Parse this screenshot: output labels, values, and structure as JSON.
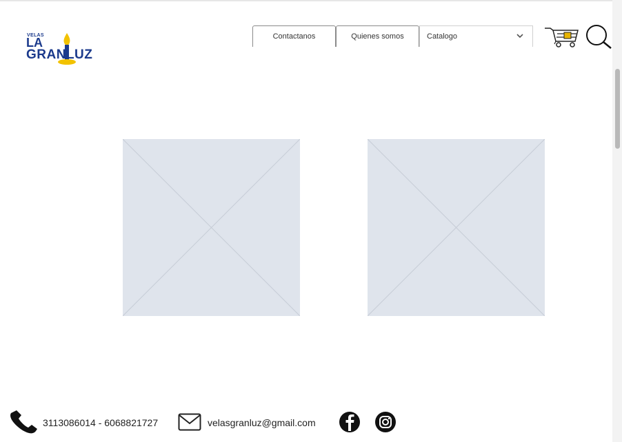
{
  "logo": {
    "small": "VELAS",
    "line1": "LA",
    "line2": "GRANLUZ"
  },
  "nav": {
    "contact_label": "Contactanos",
    "about_label": "Quienes somos",
    "catalog_selected": "Catalogo"
  },
  "icons": {
    "cart": "shopping-cart-icon",
    "search": "search-icon",
    "phone": "phone-icon",
    "mail": "mail-icon",
    "facebook": "facebook-icon",
    "instagram": "instagram-icon"
  },
  "footer": {
    "phones": "3113086014 - 6068821727",
    "email": "velasgranluz@gmail.com"
  },
  "colors": {
    "brand_blue": "#1b3a8c",
    "flame_yellow": "#f2c200",
    "placeholder": "#dfe4ec"
  }
}
